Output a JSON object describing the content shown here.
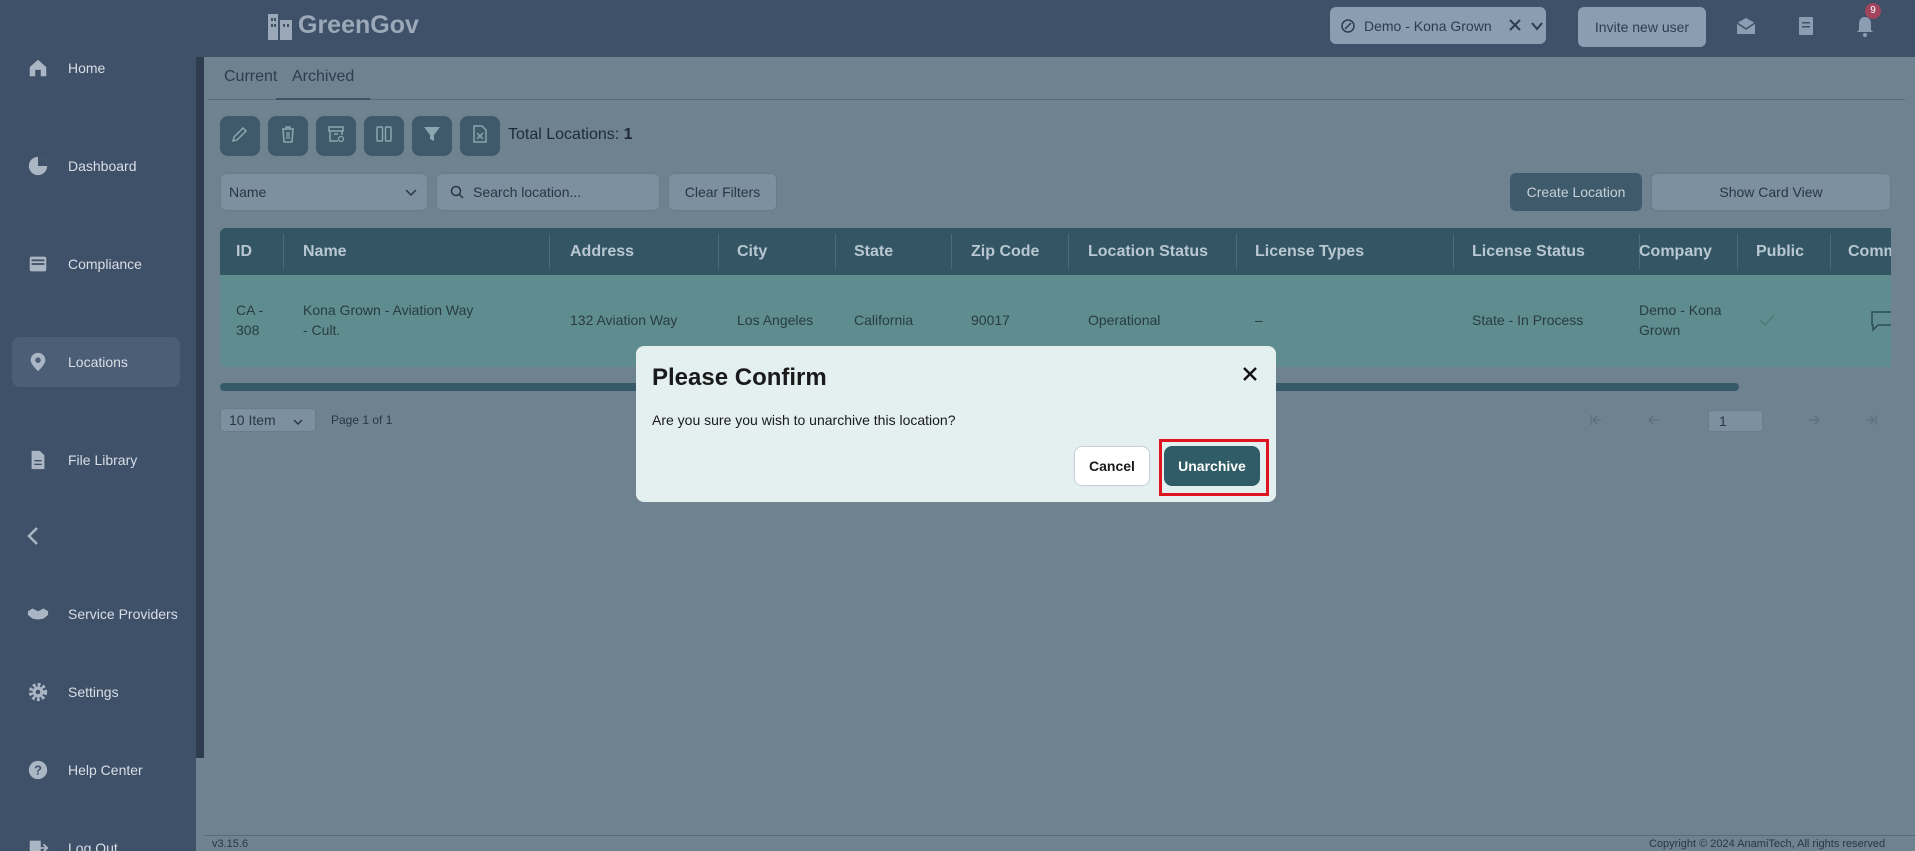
{
  "app": {
    "name": "GreenGov"
  },
  "sidebar": {
    "items": [
      {
        "label": "Home",
        "icon": "home-icon"
      },
      {
        "label": "Dashboard",
        "icon": "pie-chart-icon"
      },
      {
        "label": "Compliance",
        "icon": "inbox-icon"
      },
      {
        "label": "Locations",
        "icon": "location-pin-icon",
        "active": true
      },
      {
        "label": "File Library",
        "icon": "file-icon"
      },
      {
        "label": "Service Providers",
        "icon": "handshake-icon"
      },
      {
        "label": "Settings",
        "icon": "gear-icon"
      },
      {
        "label": "Help Center",
        "icon": "help-icon"
      },
      {
        "label": "Log Out",
        "icon": "logout-icon"
      }
    ]
  },
  "topbar": {
    "company": "Demo - Kona Grown",
    "invite_label": "Invite new user",
    "notification_count": "9"
  },
  "tabs": [
    {
      "label": "Current"
    },
    {
      "label": "Archived",
      "active": true
    }
  ],
  "toolbar": {
    "total_label": "Total Locations:",
    "total_value": "1"
  },
  "filters": {
    "sort_field": "Name",
    "search_placeholder": "Search location...",
    "clear_label": "Clear Filters",
    "create_label": "Create Location",
    "card_view_label": "Show Card View"
  },
  "table": {
    "columns": [
      "ID",
      "Name",
      "Address",
      "City",
      "State",
      "Zip Code",
      "Location Status",
      "License Types",
      "License Status",
      "Company",
      "Public",
      "Comm"
    ],
    "rows": [
      {
        "id_line1": "CA -",
        "id_line2": "308",
        "name_line1": "Kona Grown - Aviation Way",
        "name_line2": "- Cult.",
        "address": "132 Aviation Way",
        "city": "Los Angeles",
        "state": "California",
        "zip": "90017",
        "location_status": "Operational",
        "license_types": "–",
        "license_status": "State - In Process",
        "company_line1": "Demo - Kona",
        "company_line2": "Grown"
      }
    ]
  },
  "pagination": {
    "page_size": "10 Item",
    "page_info": "Page 1 of 1",
    "current_page": "1"
  },
  "footer": {
    "version": "v3.15.6",
    "copyright": "Copyright © 2024 AnamiTech, All rights reserved"
  },
  "modal": {
    "title": "Please Confirm",
    "message": "Are you sure you wish to unarchive this location?",
    "cancel_label": "Cancel",
    "confirm_label": "Unarchive"
  },
  "colors": {
    "sidebar_bg": "#3f5069",
    "accent": "#2f5c66",
    "highlight": "#e0141e"
  }
}
